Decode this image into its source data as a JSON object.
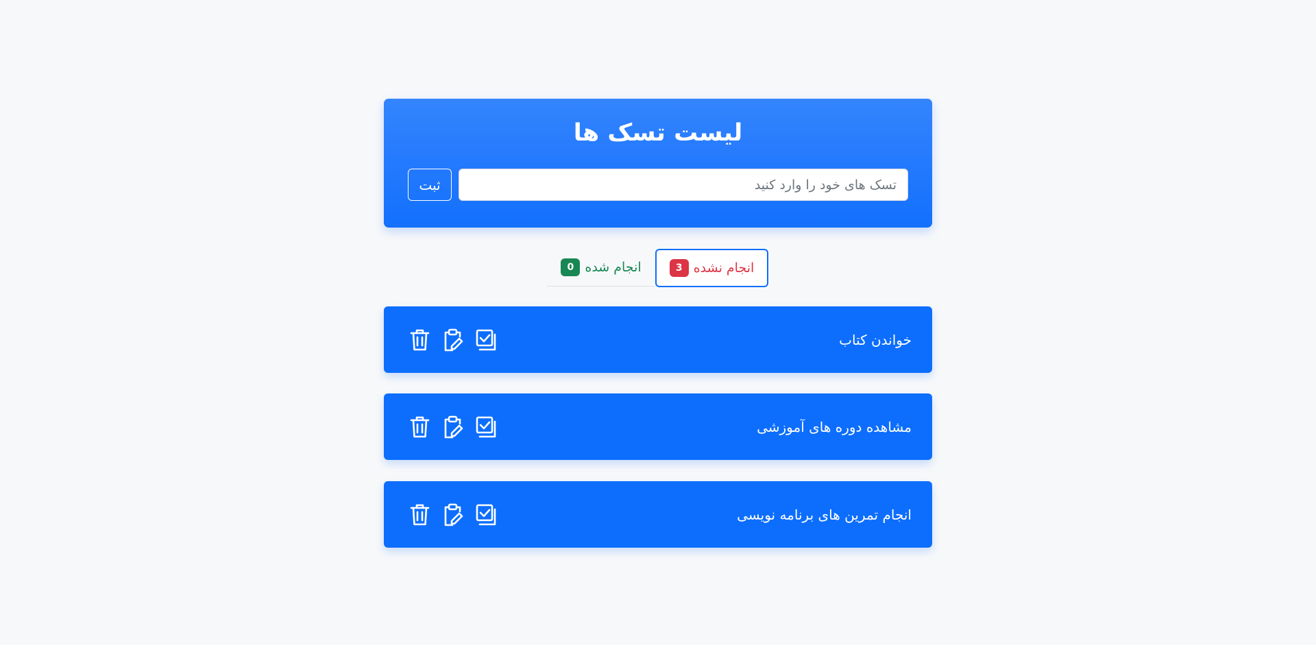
{
  "header": {
    "title": "لیست تسک ها",
    "input_placeholder": "تسک های خود را وارد کنید",
    "input_value": "",
    "submit_label": "ثبت"
  },
  "tabs": [
    {
      "label": "انجام نشده",
      "count": "3",
      "active": true,
      "color": "#dc3545"
    },
    {
      "label": "انجام شده",
      "count": "0",
      "active": false,
      "color": "#198754"
    }
  ],
  "tasks": [
    {
      "title": "خواندن کتاب",
      "actions": [
        "complete-icon",
        "edit-icon",
        "trash-icon"
      ]
    },
    {
      "title": "مشاهده دوره های آموزشی",
      "actions": [
        "complete-icon",
        "edit-icon",
        "trash-icon"
      ]
    },
    {
      "title": "انجام تمرین های برنامه نویسی",
      "actions": [
        "complete-icon",
        "edit-icon",
        "trash-icon"
      ]
    }
  ],
  "colors": {
    "primary": "#0d6efd",
    "background": "#f7f8fa",
    "danger": "#dc3545",
    "success": "#198754"
  }
}
